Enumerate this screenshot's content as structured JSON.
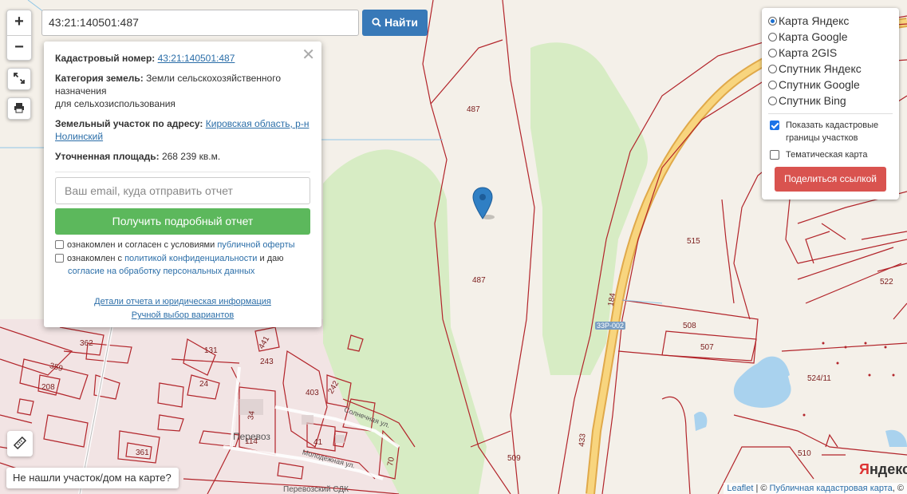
{
  "search": {
    "value": "43:21:140501:487",
    "button_label": "Найти"
  },
  "zoom": {
    "in_label": "+",
    "out_label": "−"
  },
  "popup": {
    "cad_label": "Кадастровый номер:",
    "cad_value": "43:21:140501:487",
    "category_label": "Категория земель:",
    "category_value_1": "Земли сельскохозяйственного",
    "category_value_2": "назначения",
    "category_value_3": "для сельхозиспользования",
    "address_label": "Земельный участок по адресу:",
    "address_value_1": "Кировская область, р-н",
    "address_value_2": "Нолинский",
    "area_label": "Уточненная площадь:",
    "area_value": "268 239 кв.м.",
    "email_placeholder": "Ваш email, куда отправить отчет",
    "report_button": "Получить подробный отчет",
    "agree1_text": "ознакомлен и согласен с условиями",
    "agree1_link": "публичной оферты",
    "agree2_text_a": "ознакомлен с",
    "agree2_link_a": "политикой конфиденциальности",
    "agree2_text_b": "и даю",
    "agree2_link_b": "согласие на обработку персональных данных",
    "details_link": "Детали отчета и юридическая информация",
    "manual_link": "Ручной выбор вариантов",
    "close_symbol": "✕"
  },
  "layers": {
    "options": [
      {
        "label": "Карта Яндекс",
        "selected": true
      },
      {
        "label": "Карта Google",
        "selected": false
      },
      {
        "label": "Карта 2GIS",
        "selected": false
      },
      {
        "label": "Спутник Яндекс",
        "selected": false
      },
      {
        "label": "Спутник Google",
        "selected": false
      },
      {
        "label": "Спутник Bing",
        "selected": false
      }
    ],
    "show_cadastral_1": "Показать кадастровые",
    "show_cadastral_2": "границы участков",
    "show_cadastral_checked": true,
    "thematic": "Тематическая карта",
    "thematic_checked": false,
    "share_button": "Поделиться ссылкой"
  },
  "not_found": "Не нашли участок/дом на карте?",
  "attribution": {
    "leaflet": "Leaflet",
    "sep": " | © ",
    "pkk": "Публичная кадастровая карта",
    "rest": ", ©"
  },
  "yandex_logo": {
    "y": "Я",
    "rest": "ндекс"
  },
  "map_labels": {
    "p487a": "487",
    "p487b": "487",
    "p515": "515",
    "p522": "522",
    "p508": "508",
    "p507": "507",
    "p524": "524/11",
    "p510": "510",
    "p509": "509",
    "p433": "433",
    "p184": "184",
    "road": "33Р-002",
    "p362": "362",
    "p359": "359",
    "p208": "208",
    "p131": "131",
    "p441": "441",
    "p243": "243",
    "p24": "24",
    "p403": "403",
    "p242": "242",
    "p34": "34",
    "p114": "114",
    "p41": "41",
    "p361": "361",
    "p70": "70",
    "village": "Перевоз",
    "st1": "Солнечная ул.",
    "st2": "Молодежная ул.",
    "sdk": "Перевозский СДК"
  },
  "colors": {
    "parcel": "#b2242a",
    "forest": "#d7ecc4",
    "water": "#a9d2ee",
    "road": "#f3c86a",
    "pin": "#2f7fc4"
  }
}
